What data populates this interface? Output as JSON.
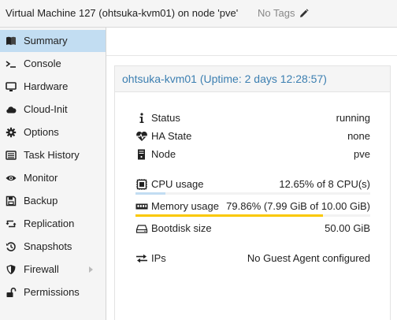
{
  "header": {
    "vm_title": "Virtual Machine 127 (ohtsuka-kvm01) on node 'pve'",
    "tags_label": "No Tags",
    "tags_icon": "pencil-icon"
  },
  "sidebar": {
    "items": [
      {
        "label": "Summary",
        "icon": "book-icon",
        "active": true
      },
      {
        "label": "Console",
        "icon": "terminal-icon"
      },
      {
        "label": "Hardware",
        "icon": "monitor-icon"
      },
      {
        "label": "Cloud-Init",
        "icon": "cloud-icon"
      },
      {
        "label": "Options",
        "icon": "gear-icon"
      },
      {
        "label": "Task History",
        "icon": "list-icon"
      },
      {
        "label": "Monitor",
        "icon": "eye-icon"
      },
      {
        "label": "Backup",
        "icon": "floppy-icon"
      },
      {
        "label": "Replication",
        "icon": "retweet-icon"
      },
      {
        "label": "Snapshots",
        "icon": "history-icon"
      },
      {
        "label": "Firewall",
        "icon": "shield-icon",
        "has_submenu": true
      },
      {
        "label": "Permissions",
        "icon": "unlock-icon"
      }
    ]
  },
  "summary": {
    "title": "ohtsuka-kvm01 (Uptime: 2 days 12:28:57)",
    "status": {
      "label": "Status",
      "value": "running",
      "icon": "info-icon"
    },
    "ha_state": {
      "label": "HA State",
      "value": "none",
      "icon": "heartbeat-icon"
    },
    "node": {
      "label": "Node",
      "value": "pve",
      "icon": "server-icon"
    },
    "cpu": {
      "label": "CPU usage",
      "value": "12.65% of 8 CPU(s)",
      "icon": "cpu-icon",
      "percent": 12.65,
      "color": "#c2ddf2"
    },
    "memory": {
      "label": "Memory usage",
      "value": "79.86% (7.99 GiB of 10.00 GiB)",
      "icon": "memory-icon",
      "percent": 79.86,
      "color": "#fac800"
    },
    "bootdisk": {
      "label": "Bootdisk size",
      "value": "50.00 GiB",
      "icon": "hdd-icon"
    },
    "ips": {
      "label": "IPs",
      "value": "No Guest Agent configured",
      "icon": "exchange-icon"
    }
  },
  "colors": {
    "accent": "#3c7fb1",
    "selected": "#c2ddf2",
    "memory_bar": "#fac800"
  }
}
